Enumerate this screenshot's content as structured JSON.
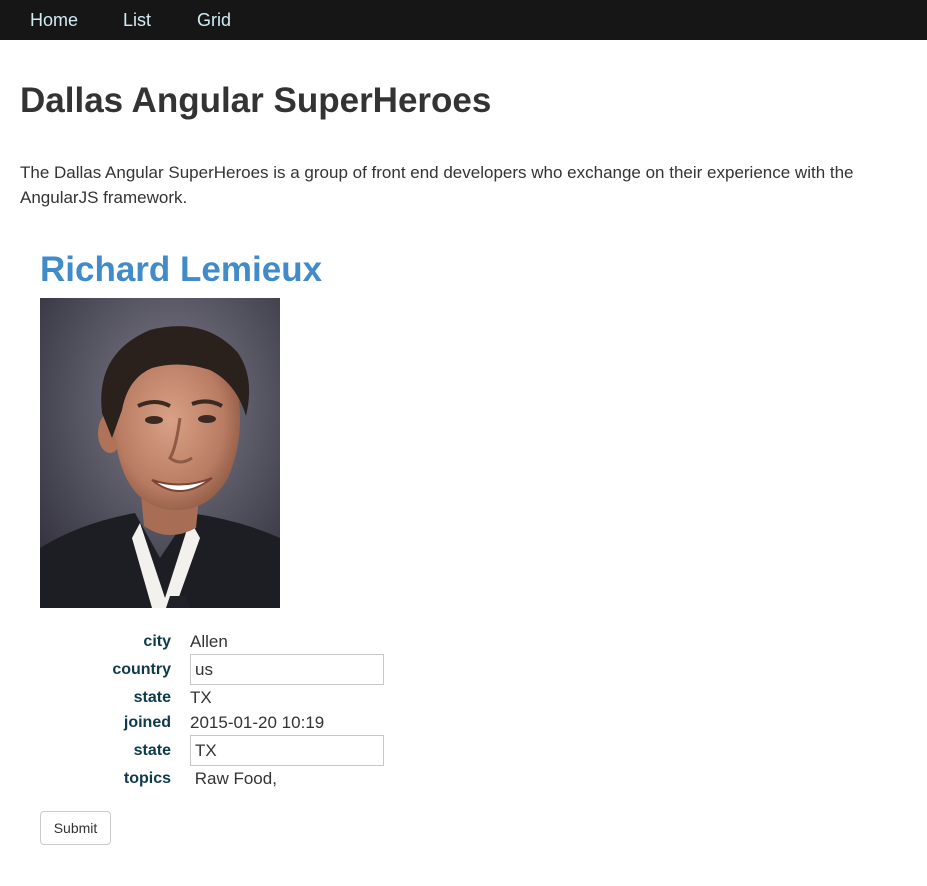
{
  "nav": {
    "items": [
      {
        "label": "Home"
      },
      {
        "label": "List"
      },
      {
        "label": "Grid"
      }
    ]
  },
  "page": {
    "title": "Dallas Angular SuperHeroes",
    "intro": "The Dallas Angular SuperHeroes is a group of front end developers who exchange on their experience with the AngularJS framework."
  },
  "hero": {
    "name": "Richard Lemieux",
    "fields": {
      "city": {
        "label": "city",
        "value": "Allen"
      },
      "country": {
        "label": "country",
        "value": "us"
      },
      "state_text": {
        "label": "state",
        "value": "TX"
      },
      "joined": {
        "label": "joined",
        "value": "2015-01-20 10:19"
      },
      "state_input": {
        "label": "state",
        "value": "TX"
      },
      "topics": {
        "label": "topics",
        "value": " Raw Food,"
      }
    }
  },
  "form": {
    "submit_label": "Submit"
  },
  "colors": {
    "navbar_bg": "#161616",
    "nav_link": "#d2ecf4",
    "hero_name": "#428bca",
    "field_label": "#0d3b4a"
  }
}
